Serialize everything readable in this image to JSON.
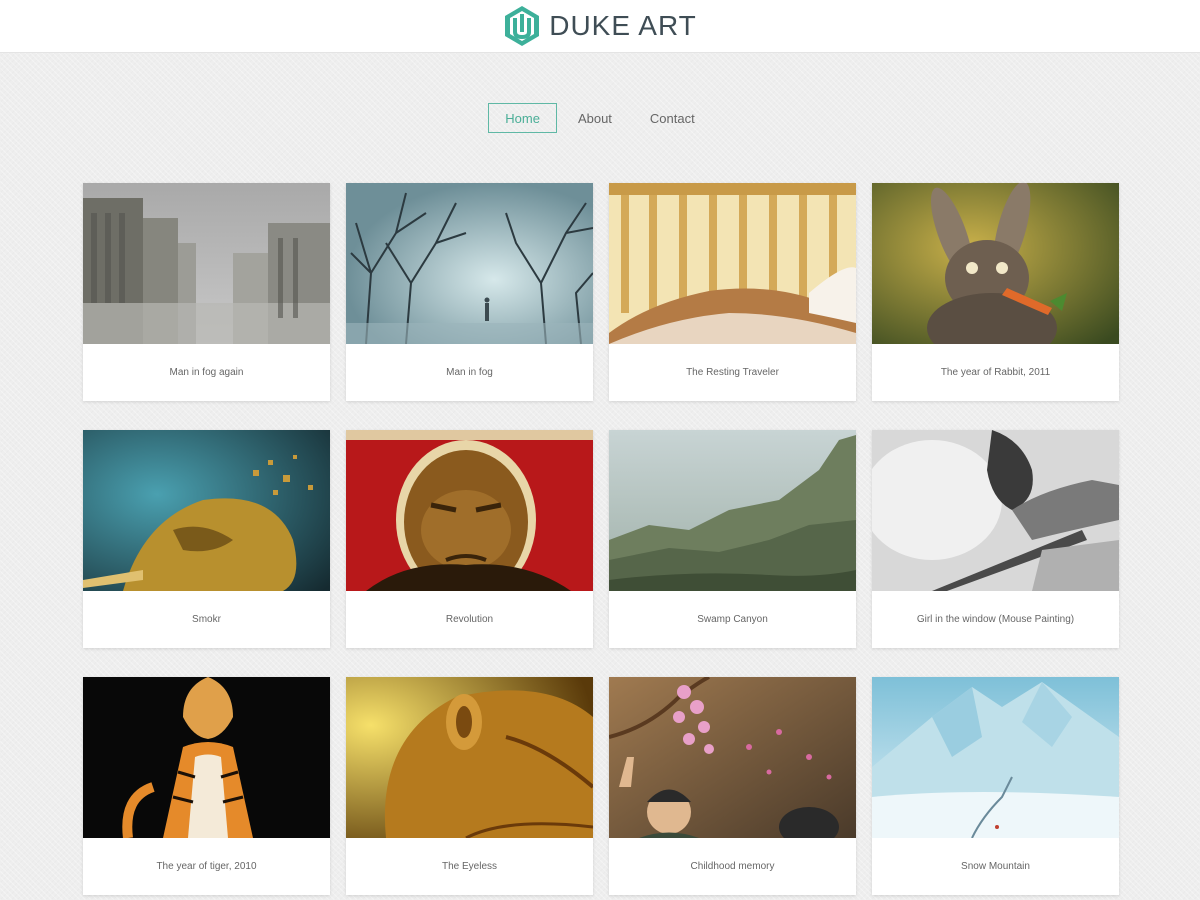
{
  "header": {
    "logo_text": "DUKE ART",
    "logo_icon": "hexagon-logo-icon",
    "accent_color": "#3db09a"
  },
  "nav": {
    "items": [
      {
        "label": "Home",
        "active": true
      },
      {
        "label": "About",
        "active": false
      },
      {
        "label": "Contact",
        "active": false
      }
    ]
  },
  "gallery": {
    "items": [
      {
        "title": "Man in fog again"
      },
      {
        "title": "Man in fog"
      },
      {
        "title": "The Resting Traveler"
      },
      {
        "title": "The year of Rabbit, 2011"
      },
      {
        "title": "Smokr"
      },
      {
        "title": "Revolution"
      },
      {
        "title": "Swamp Canyon"
      },
      {
        "title": "Girl in the window (Mouse Painting)"
      },
      {
        "title": "The year of tiger, 2010"
      },
      {
        "title": "The Eyeless"
      },
      {
        "title": "Childhood memory"
      },
      {
        "title": "Snow Mountain"
      }
    ]
  }
}
